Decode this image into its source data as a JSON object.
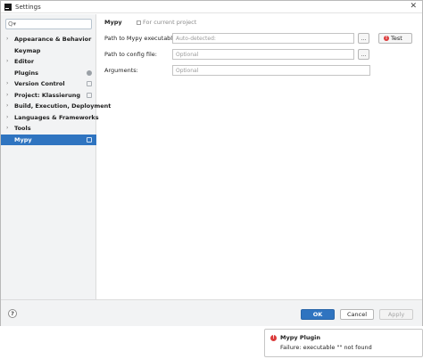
{
  "window": {
    "title": "Settings",
    "close_glyph": "✕"
  },
  "sidebar": {
    "search": {
      "value": "",
      "placeholder": "",
      "icon_glyph": "Q▾"
    },
    "items": [
      {
        "label": "Appearance & Behavior",
        "arrow": "›"
      },
      {
        "label": "Keymap"
      },
      {
        "label": "Editor",
        "arrow": "›"
      },
      {
        "label": "Plugins",
        "badge": true
      },
      {
        "label": "Version Control",
        "arrow": "›",
        "project": true
      },
      {
        "label": "Project: Klassierung",
        "arrow": "›",
        "project": true
      },
      {
        "label": "Build, Execution, Deployment",
        "arrow": "›"
      },
      {
        "label": "Languages & Frameworks",
        "arrow": "›"
      },
      {
        "label": "Tools",
        "arrow": "›"
      },
      {
        "label": "Mypy",
        "selected": true,
        "project": true
      }
    ]
  },
  "main": {
    "heading": "Mypy",
    "scope_label": "For current project",
    "rows": [
      {
        "label": "Path to Mypy executable:",
        "placeholder": "Auto-detected:",
        "value": ""
      },
      {
        "label": "Path to config file:",
        "placeholder": "Optional",
        "value": ""
      },
      {
        "label": "Arguments:",
        "placeholder": "Optional",
        "value": ""
      }
    ],
    "browse_label": "...",
    "test_label": "Test"
  },
  "footer": {
    "help_label": "?",
    "ok_label": "OK",
    "cancel_label": "Cancel",
    "apply_label": "Apply"
  },
  "notification": {
    "title": "Mypy Plugin",
    "message": "Failure: executable \"\" not found"
  },
  "colors": {
    "accent": "#2f74c0",
    "error": "#db3b3b",
    "sidebar_bg": "#f2f3f4"
  }
}
